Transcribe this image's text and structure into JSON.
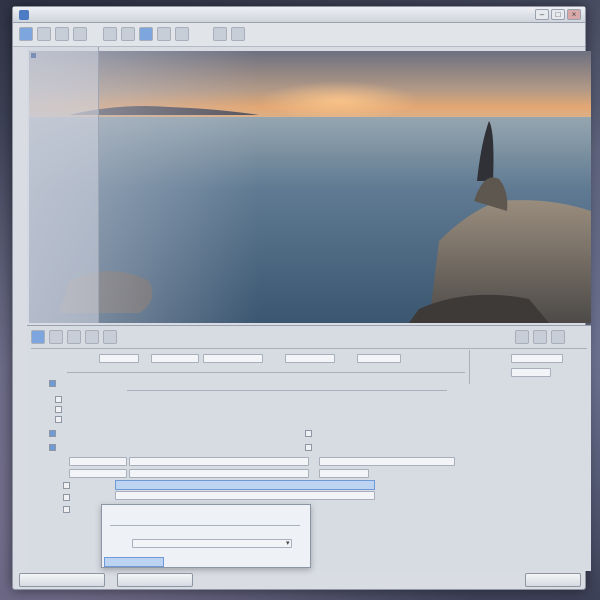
{
  "window": {
    "title": "",
    "menu": [
      "",
      "",
      "",
      "",
      "",
      ""
    ]
  },
  "toolbar": {
    "zoom_label": ""
  },
  "left_panel": {
    "items": [
      "",
      "",
      "",
      "",
      "",
      "",
      "",
      "",
      "",
      "",
      "",
      "",
      "",
      "",
      "",
      "",
      "",
      "",
      "",
      "",
      ""
    ]
  },
  "settings": {
    "row1_labels": [
      "",
      "",
      "",
      "",
      ""
    ],
    "options": [
      "",
      "",
      "",
      ""
    ],
    "fields": [
      "",
      "",
      "",
      "",
      ""
    ],
    "list_rows": [
      "",
      "",
      "",
      "",
      ""
    ],
    "selected_row": ""
  },
  "popup": {
    "header": "",
    "combo_value": "",
    "item": ""
  },
  "footer": {
    "left_button": "",
    "mid_button": "",
    "right_button": ""
  },
  "colors": {
    "accent": "#6f9ad6",
    "selection": "#bcd3f2"
  }
}
